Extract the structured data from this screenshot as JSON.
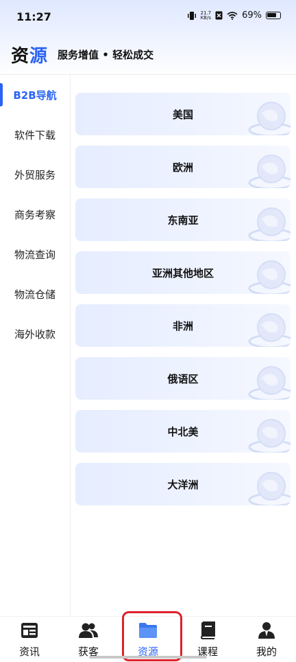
{
  "status": {
    "time": "11:27",
    "speed_top": "21.7",
    "speed_bottom": "KB/s",
    "battery": "69%"
  },
  "header": {
    "logo_part1": "资",
    "logo_part2": "源",
    "slogan": "服务增值 • 轻松成交"
  },
  "sidebar": {
    "items": [
      {
        "label": "B2B导航",
        "active": true
      },
      {
        "label": "软件下载"
      },
      {
        "label": "外贸服务"
      },
      {
        "label": "商务考察"
      },
      {
        "label": "物流查询"
      },
      {
        "label": "物流仓储"
      },
      {
        "label": "海外收款"
      }
    ]
  },
  "regions": [
    "美国",
    "欧洲",
    "东南亚",
    "亚洲其他地区",
    "非洲",
    "俄语区",
    "中北美",
    "大洋洲"
  ],
  "bottom_nav": [
    {
      "label": "资讯",
      "icon": "news-icon"
    },
    {
      "label": "获客",
      "icon": "users-icon"
    },
    {
      "label": "资源",
      "icon": "folder-icon",
      "active": true
    },
    {
      "label": "课程",
      "icon": "book-icon"
    },
    {
      "label": "我的",
      "icon": "person-icon"
    }
  ],
  "colors": {
    "accent": "#2a63f5",
    "highlight": "#e0202a"
  }
}
